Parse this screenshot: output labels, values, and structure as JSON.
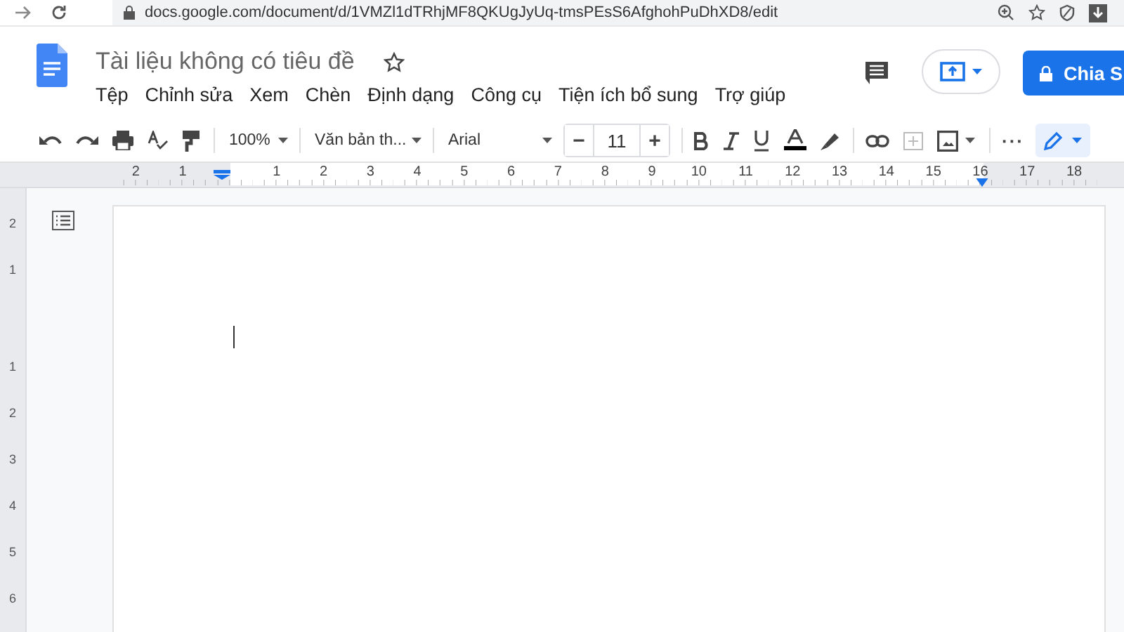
{
  "browser": {
    "url": "docs.google.com/document/d/1VMZl1dTRhjMF8QKUgJyUq-tmsPEsS6AfghohPuDhXD8/edit"
  },
  "document": {
    "title": "Tài liệu không có tiêu đề"
  },
  "menu": [
    "Tệp",
    "Chỉnh sửa",
    "Xem",
    "Chèn",
    "Định dạng",
    "Công cụ",
    "Tiện ích bổ sung",
    "Trợ giúp"
  ],
  "share_button": {
    "label": "Chia S"
  },
  "toolbar": {
    "zoom": "100%",
    "style": "Văn bản th...",
    "font": "Arial",
    "font_size": "11",
    "decrease": "−",
    "increase": "+",
    "more": "···",
    "editing_mode_selected": true
  },
  "ruler": {
    "labels": [
      "2",
      "1",
      "1",
      "2",
      "3",
      "4",
      "5",
      "6",
      "7",
      "8",
      "9",
      "10",
      "11",
      "12",
      "13",
      "14",
      "15",
      "16",
      "17",
      "18"
    ]
  },
  "vertical_ruler": {
    "labels": [
      "2",
      "1",
      "1",
      "2",
      "3",
      "4",
      "5",
      "6"
    ]
  }
}
